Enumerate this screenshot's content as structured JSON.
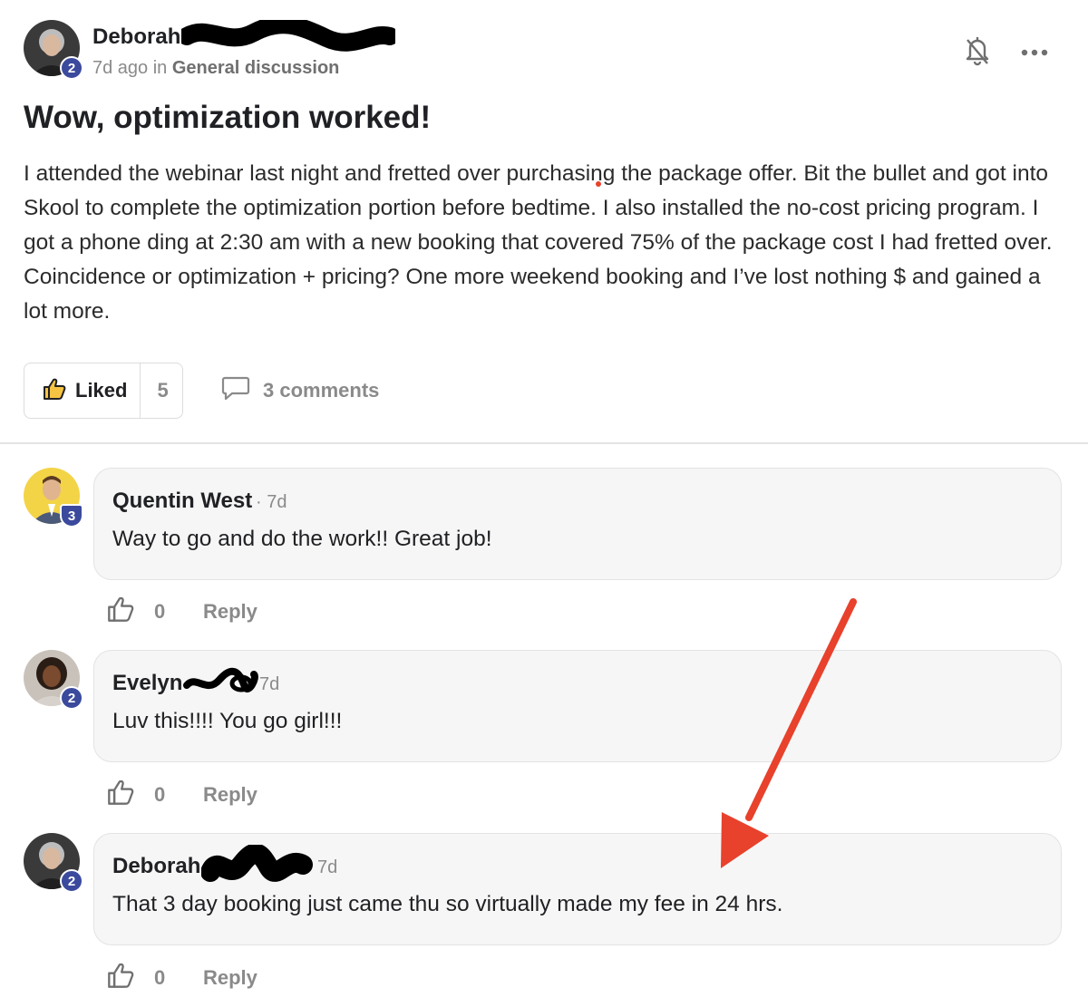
{
  "post": {
    "author": "Deborah",
    "author_level": "2",
    "time": "7d ago in",
    "category": "General discussion",
    "title": "Wow, optimization worked!",
    "body": "I attended the webinar last night and fretted over purchasing the package offer. Bit the bullet and got into Skool to complete the optimization portion before bedtime. I also installed the no-cost pricing program. I got a phone ding at 2:30 am with a new booking that covered 75% of the package cost I had fretted over. Coincidence or optimization + pricing? One more weekend booking and I’ve lost nothing $ and gained a lot more.",
    "like_label": "Liked",
    "like_count": "5",
    "comments_label": "3 comments"
  },
  "icons": {
    "notify": "bell-off-icon",
    "more": "more-dots-icon",
    "like": "thumbs-up-icon",
    "comment": "comment-bubble-icon"
  },
  "colors": {
    "level_badge": "#3b4a9c",
    "annotation_arrow": "#e8412c",
    "bubble_bg": "#f6f6f6"
  },
  "comments": [
    {
      "author": "Quentin West",
      "time": "· 7d",
      "level": "3",
      "text": "Way to go and do the work!! Great job!",
      "likes": "0",
      "reply": "Reply"
    },
    {
      "author": "Evelyn",
      "time": "7d",
      "level": "2",
      "text": "Luv this!!!! You go girl!!!",
      "likes": "0",
      "reply": "Reply"
    },
    {
      "author": "Deborah",
      "time": "7d",
      "level": "2",
      "text": "That 3 day booking just came thu so virtually made my fee in 24 hrs.",
      "likes": "0",
      "reply": "Reply"
    }
  ]
}
